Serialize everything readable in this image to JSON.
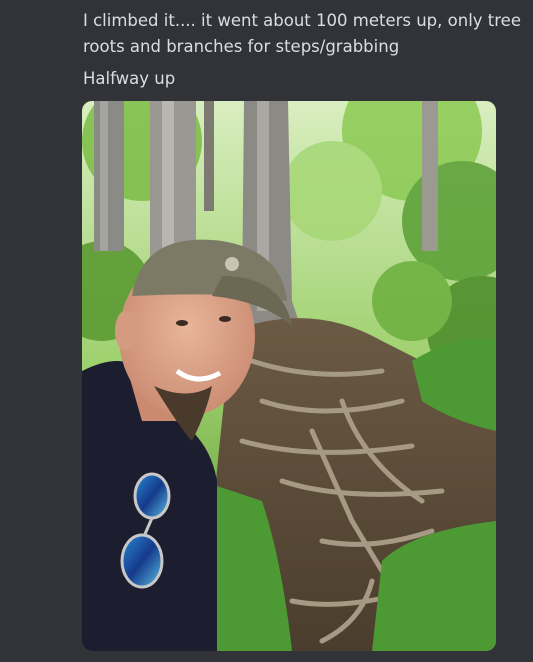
{
  "message": {
    "line1": "I climbed it.... it went about 100 meters up, only tree roots and branches for steps/grabbing",
    "line2": "Halfway up"
  },
  "attachment": {
    "type": "image",
    "subject": "selfie on forest trail with tree roots"
  },
  "colors": {
    "background": "#313338",
    "text": "#dbdee1"
  }
}
